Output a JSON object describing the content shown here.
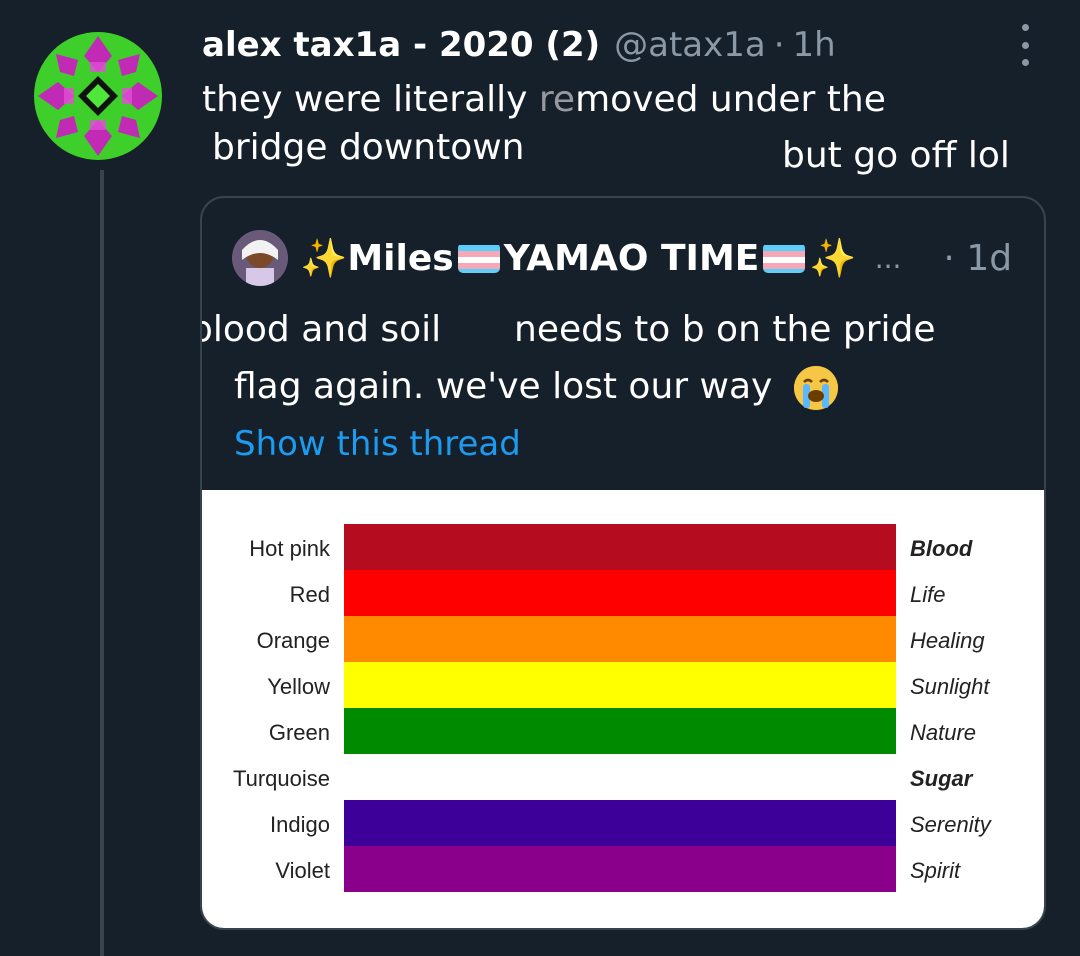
{
  "tweet": {
    "display_name": "alex tax1a - 2020 (2)",
    "handle": "@atax1a",
    "separator": "·",
    "time": "1h",
    "text_line1a": "they were literally ",
    "text_overlay": "re",
    "text_line1b": "moved under the",
    "text_line2": "bridge downtown",
    "text_line3": "but go off lol"
  },
  "quote": {
    "display_name": "Miles",
    "name_middle": "YAMAO TIME",
    "ellipsis": "...",
    "separator": "·",
    "time": "1d",
    "line1a": "blood and soil",
    "line1b": "needs to b on the pride",
    "line2": "flag again. we've lost our way",
    "show_thread": "Show this thread"
  },
  "flag": {
    "rows": [
      {
        "color_name": "Hot pink",
        "meaning": "Blood",
        "hex": "#b50d1f"
      },
      {
        "color_name": "Red",
        "meaning": "Life",
        "hex": "#ff0000"
      },
      {
        "color_name": "Orange",
        "meaning": "Healing",
        "hex": "#ff8a00"
      },
      {
        "color_name": "Yellow",
        "meaning": "Sunlight",
        "hex": "#ffff00"
      },
      {
        "color_name": "Green",
        "meaning": "Nature",
        "hex": "#008a00"
      },
      {
        "color_name": "Turquoise",
        "meaning": "Sugar",
        "hex": "#ffffff"
      },
      {
        "color_name": "Indigo",
        "meaning": "Serenity",
        "hex": "#3d0099"
      },
      {
        "color_name": "Violet",
        "meaning": "Spirit",
        "hex": "#8a008a"
      }
    ]
  },
  "colors": {
    "background": "#16202a",
    "secondary_text": "#8b98a5",
    "link": "#1d9bf0",
    "border": "#38444d"
  }
}
